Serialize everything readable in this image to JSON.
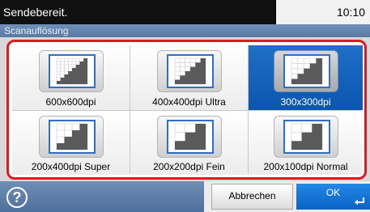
{
  "status": {
    "message": "Sendebereit.",
    "time": "10:10"
  },
  "screen": {
    "title": "Scanauflösung"
  },
  "options": [
    {
      "label": "600x600dpi",
      "icon": "resolution-600x600-icon",
      "selected": false
    },
    {
      "label": "400x400dpi Ultra",
      "icon": "resolution-400x400-icon",
      "selected": false
    },
    {
      "label": "300x300dpi",
      "icon": "resolution-300x300-icon",
      "selected": true
    },
    {
      "label": "200x400dpi Super",
      "icon": "resolution-200x400-icon",
      "selected": false
    },
    {
      "label": "200x200dpi Fein",
      "icon": "resolution-200x200-icon",
      "selected": false
    },
    {
      "label": "200x100dpi Normal",
      "icon": "resolution-200x100-icon",
      "selected": false
    }
  ],
  "footer": {
    "help_icon": "help-icon",
    "help_glyph": "?",
    "cancel_label": "Abbrechen",
    "ok_label": "OK",
    "ok_icon": "enter-icon"
  },
  "colors": {
    "selected": "#0b55ad",
    "frame": "#e0181f",
    "titlebar": "#5a7aa4"
  }
}
